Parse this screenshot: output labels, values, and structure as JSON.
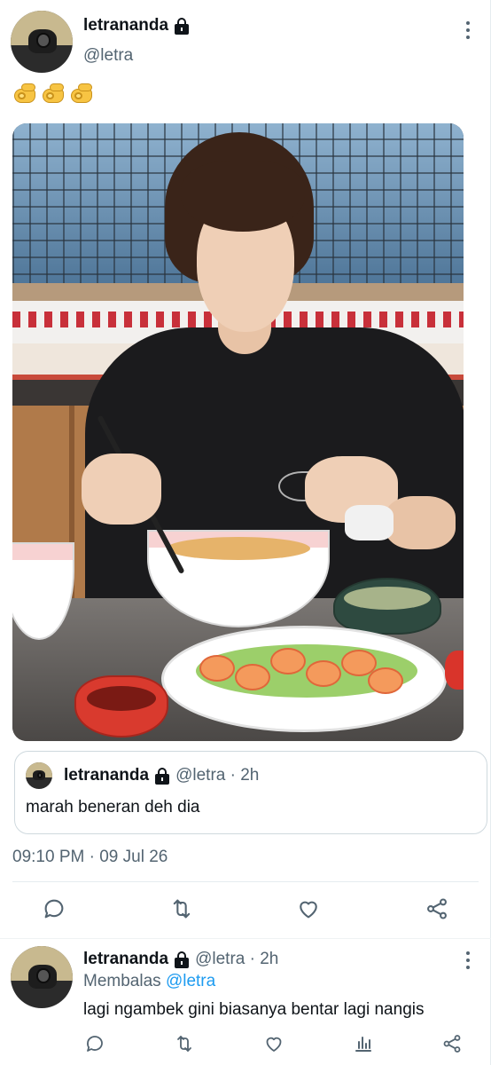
{
  "tweet": {
    "display_name": "letrananda",
    "handle": "@letra",
    "emoji_text": "🫰🫰🫰",
    "timestamp": "09:10 PM · 09 Jul 26"
  },
  "quote": {
    "display_name": "letrananda",
    "meta": "@letra · 2h",
    "text": "marah beneran deh dia"
  },
  "actions": {
    "icons": [
      "reply-icon",
      "retweet-icon",
      "like-icon",
      "share-icon"
    ]
  },
  "reply": {
    "display_name": "letrananda",
    "meta": "@letra · 2h",
    "replying_prefix": "Membalas",
    "replying_to": "@letra",
    "text": "lagi ngambek gini biasanya bentar lagi nangis",
    "icons": [
      "reply-icon",
      "retweet-icon",
      "like-icon",
      "views-icon",
      "share-icon"
    ]
  },
  "colors": {
    "text_primary": "#0f1419",
    "text_secondary": "#536471",
    "accent": "#1d9bf0",
    "border": "#cfd9de"
  }
}
